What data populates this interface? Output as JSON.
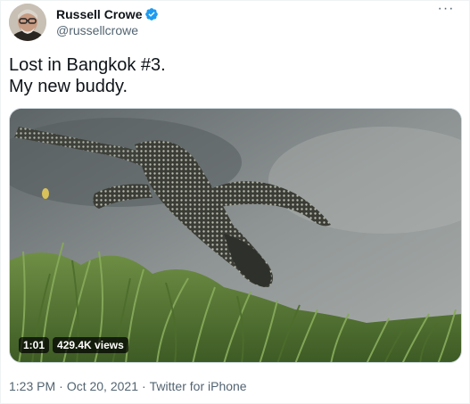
{
  "user": {
    "display_name": "Russell Crowe",
    "handle": "@russellcrowe",
    "verified": true
  },
  "tweet": {
    "text_lines": [
      "Lost in Bangkok #3.",
      "My new buddy."
    ]
  },
  "video": {
    "duration": "1:01",
    "views": "429.4K views"
  },
  "footer": {
    "time": "1:23 PM",
    "separator": "·",
    "date": "Oct 20, 2021",
    "source": "Twitter for iPhone"
  },
  "colors": {
    "verified_badge": "#1d9bf0",
    "secondary_text": "#536471",
    "primary_text": "#0f1419"
  },
  "icons": {
    "verified": "verified-badge-icon",
    "more": "more-options-icon"
  }
}
